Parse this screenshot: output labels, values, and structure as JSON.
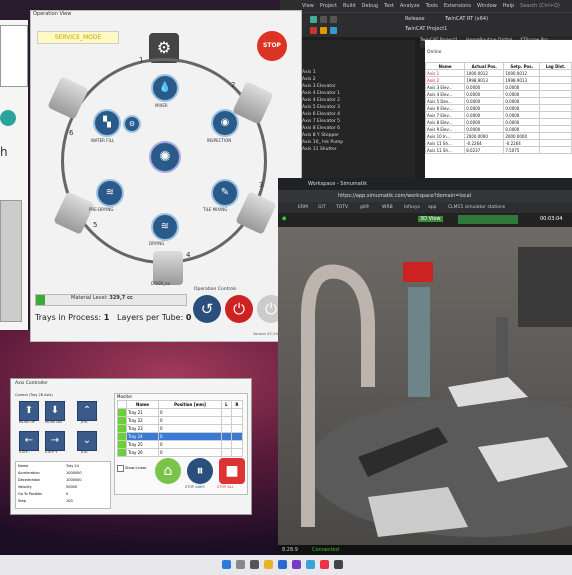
{
  "vs": {
    "menu": [
      "View",
      "Project",
      "Build",
      "Debug",
      "Test",
      "Analyze",
      "Tools",
      "Extensions",
      "Window",
      "Help"
    ],
    "search": "Search (Ctrl+Q)",
    "config": "Release",
    "target": "TwinCAT RT (x64)",
    "project": "TwinCAT Project1",
    "tabs": [
      "TwinCAT Project1",
      "HomeRoutine Drittel",
      "YTScope Pro"
    ],
    "tree_items": [
      "Axis 1",
      "Axis 2",
      "Axis 3 Elevator",
      "Axis 4 Elevator 1",
      "Axis 4 Elevator 2",
      "Axis 5 Elevator 3",
      "Axis 6 Elevator 4",
      "Axis 7 Elevator 5",
      "Axis 8 Elevator 6",
      "Axis 8 Y Stopper",
      "Axis 10_ Ink Pump",
      "Axis 11 Shutter"
    ],
    "online_label": "Online",
    "grid": {
      "headers": [
        "Name",
        "Actual Pos.",
        "Setp. Pos.",
        "Lag Dist."
      ],
      "rows": [
        [
          "Axis 1",
          "1000.0012",
          "1000.0012",
          ""
        ],
        [
          "Axis 2",
          "1998.9013",
          "1998.9013",
          ""
        ],
        [
          "Axis 3 Elev...",
          "0.0000",
          "0.0000",
          ""
        ],
        [
          "Axis 4 Elev...",
          "0.0000",
          "0.0000",
          ""
        ],
        [
          "Axis 5 Dev...",
          "0.0000",
          "0.0000",
          ""
        ],
        [
          "Axis 6 Elev...",
          "0.0000",
          "0.0000",
          ""
        ],
        [
          "Axis 7 Elev...",
          "0.0000",
          "0.0000",
          ""
        ],
        [
          "Axis 8 Elev...",
          "0.0000",
          "0.0000",
          ""
        ],
        [
          "Axis 9 Elev...",
          "0.0000",
          "0.0000",
          ""
        ],
        [
          "Axis 10 In...",
          "2000.0000",
          "2000.0000",
          ""
        ],
        [
          "Axis 11 Sh...",
          "-0.2264",
          "-0.2264",
          ""
        ],
        [
          "Axis 11 Sh...",
          "8.0237",
          "7.5075",
          ""
        ]
      ]
    }
  },
  "op": {
    "header": "Operation View",
    "mode": "SERVICE_MODE",
    "stop": "STOP",
    "stations": [
      {
        "num": "1",
        "label": ""
      },
      {
        "num": "",
        "label": "MIXER"
      },
      {
        "num": "2",
        "label": "INSPECTION"
      },
      {
        "num": "3",
        "label": "TILE MIXING"
      },
      {
        "num": "4",
        "label": "DRYING"
      },
      {
        "num": "5",
        "label": "PRE-DRYING"
      },
      {
        "num": "6",
        "label": "WATER FILL"
      }
    ],
    "door": "DOOR_xx",
    "material_label": "Material Level:",
    "material_value": "329,7 cc",
    "material_fraction": 0.06,
    "trays_label": "Trays in Process:",
    "trays_value": "1",
    "layers_label": "Layers per Tube:",
    "layers_value": "0",
    "controls_title": "Operation Controls",
    "version": "Version V3.3.0"
  },
  "sim": {
    "tab": "Workspace - Simumatik",
    "url": "https://app.simumatik.com/workspace?domain=local",
    "bookmarks": [
      "ERM",
      "GIT",
      "TOTV",
      "git9",
      "WRB",
      "Infosys",
      "app",
      "CLM15 simulator stations"
    ],
    "view_label": "3D View",
    "timer": "00:03:04",
    "status_left": "8.28.9",
    "status_conn": "Connected"
  },
  "axis": {
    "title": "Axis Controller",
    "control_label": "Control (Tray 28 Axis)",
    "buttons": [
      "MOVE UP",
      "MOVE DN",
      "JOG",
      "STEP -",
      "STEP +",
      "JOG"
    ],
    "params": [
      {
        "k": "Name",
        "v": "Tray 24"
      },
      {
        "k": "Acceleration",
        "v": "1000000"
      },
      {
        "k": "Deceleration",
        "v": "1000000"
      },
      {
        "k": "Velocity",
        "v": "50000"
      },
      {
        "k": "Go To Position",
        "v": "0"
      },
      {
        "k": "Step",
        "v": "100"
      }
    ],
    "monitor_label": "Monitor",
    "mon_headers": [
      "",
      "Name",
      "Position [mm]",
      "L",
      "R"
    ],
    "mon_rows": [
      {
        "name": "Tray 21",
        "pos": "0",
        "sel": false
      },
      {
        "name": "Tray 22",
        "pos": "0",
        "sel": false
      },
      {
        "name": "Tray 23",
        "pos": "0",
        "sel": false
      },
      {
        "name": "Tray 24",
        "pos": "0",
        "sel": true
      },
      {
        "name": "Tray 25",
        "pos": "0",
        "sel": false
      },
      {
        "name": "Tray 26",
        "pos": "0",
        "sel": false
      }
    ],
    "show_linear": "Show Linear",
    "stop_axes": "STOP AXES",
    "stop_all": "STOP ALL"
  },
  "left": {
    "letter": "h"
  }
}
